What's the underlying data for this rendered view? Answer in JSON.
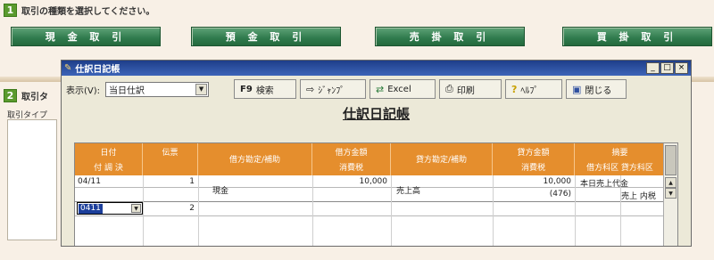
{
  "step1": {
    "num": "1",
    "text": "取引の種類を選択してください。"
  },
  "transaction_buttons": [
    "現 金 取 引",
    "預 金 取 引",
    "売 掛 取 引",
    "買 掛 取 引"
  ],
  "step2": {
    "num": "2",
    "text": "取引タ"
  },
  "side_label": "取引タイプ",
  "window": {
    "title": "仕訳日記帳",
    "controls": {
      "minimize": "_",
      "maximize": "□",
      "close": "×"
    }
  },
  "toolbar": {
    "display_label": "表示(V):",
    "display_value": "当日仕訳",
    "search": {
      "key": "F9",
      "label": "検索",
      "icon": "search"
    },
    "jump": {
      "label": "ｼﾞｬﾝﾌﾟ",
      "icon": "jump-icon"
    },
    "excel": {
      "label": "Excel",
      "icon": "excel-icon"
    },
    "print": {
      "label": "印刷",
      "icon": "printer-icon"
    },
    "help": {
      "label": "ﾍﾙﾌﾟ",
      "icon": "help-icon"
    },
    "close": {
      "label": "閉じる",
      "icon": "close-door-icon"
    }
  },
  "journal_title": "仕訳日記帳",
  "table": {
    "headers": {
      "date": "日付",
      "date_sub": "付 調 決",
      "voucher": "伝票",
      "debit_account": "借方勘定/補助",
      "debit_amount": "借方金額",
      "debit_tax": "消費税",
      "credit_account": "貸方勘定/補助",
      "credit_amount": "貸方金額",
      "credit_tax": "消費税",
      "memo": "摘要",
      "memo_sub": "借方科区 貸方科区"
    },
    "row1": {
      "date": "04/11",
      "voucher": "1",
      "debit_account": "現金",
      "debit_amount": "10,000",
      "credit_account": "売上高",
      "credit_amount": "10,000",
      "credit_tax": "(476)",
      "memo": "本日売上代金",
      "memo2": "売上 内税"
    },
    "row2": {
      "date_input": "0411",
      "voucher": "2"
    }
  }
}
